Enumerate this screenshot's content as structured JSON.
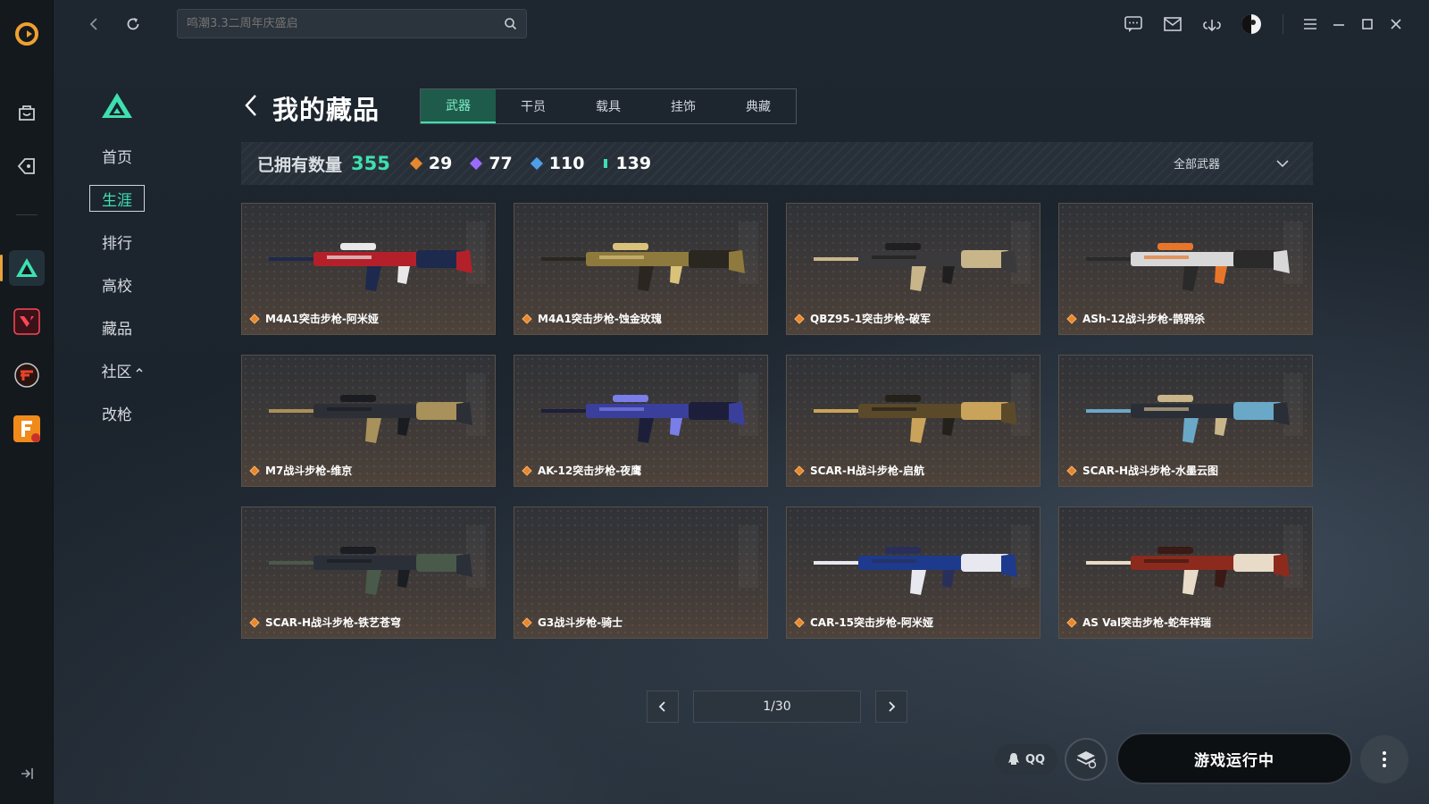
{
  "search": {
    "placeholder": "鸣潮3.3二周年庆盛启"
  },
  "sidenav": {
    "items": [
      {
        "label": "首页"
      },
      {
        "label": "生涯"
      },
      {
        "label": "排行"
      },
      {
        "label": "高校"
      },
      {
        "label": "藏品"
      },
      {
        "label": "社区"
      },
      {
        "label": "改枪"
      }
    ],
    "active_index": 1
  },
  "page": {
    "title": "我的藏品",
    "tabs": [
      {
        "label": "武器"
      },
      {
        "label": "干员"
      },
      {
        "label": "载具"
      },
      {
        "label": "挂饰"
      },
      {
        "label": "典藏"
      }
    ],
    "active_tab": 0
  },
  "stats": {
    "owned_label": "已拥有数量",
    "owned_total": "355",
    "tiers": [
      {
        "value": "29",
        "color": "#e7882e"
      },
      {
        "value": "77",
        "color": "#9b6bff"
      },
      {
        "value": "110",
        "color": "#4f9eea"
      },
      {
        "value": "139",
        "color": "#3ee0b0"
      }
    ],
    "filter_label": "全部武器"
  },
  "items": [
    {
      "name": "M4A1突击步枪-阿米娅",
      "colors": [
        "#b3202a",
        "#1d2a4d",
        "#e8e8e8"
      ]
    },
    {
      "name": "M4A1突击步枪-蚀金玫瑰",
      "colors": [
        "#8e7a3c",
        "#2a2620",
        "#d9c27a"
      ]
    },
    {
      "name": "QBZ95-1突击步枪-破军",
      "colors": [
        "#3a3a3c",
        "#c8b58a",
        "#1f1f20"
      ]
    },
    {
      "name": "ASh-12战斗步枪-鹊鸦杀",
      "colors": [
        "#d8d8d8",
        "#2a2a2a",
        "#e8762a"
      ]
    },
    {
      "name": "M7战斗步枪-维京",
      "colors": [
        "#2d2f36",
        "#a8915a",
        "#1a1c22"
      ]
    },
    {
      "name": "AK-12突击步枪-夜鹰",
      "colors": [
        "#3a3f9c",
        "#1d1f3a",
        "#7a7ee8"
      ]
    },
    {
      "name": "SCAR-H战斗步枪-启航",
      "colors": [
        "#5a4a2a",
        "#c9a35a",
        "#24201a"
      ]
    },
    {
      "name": "SCAR-H战斗步枪-水墨云图",
      "colors": [
        "#2a2e36",
        "#6aa8c8",
        "#c8b58a"
      ]
    },
    {
      "name": "SCAR-H战斗步枪-铁艺苍穹",
      "colors": [
        "#2a2f38",
        "#4a5a4a",
        "#1a1d22"
      ]
    },
    {
      "name": "G3战斗步枪-骑士",
      "colors": []
    },
    {
      "name": "CAR-15突击步枪-阿米娅",
      "colors": [
        "#1d3a8c",
        "#e8e8f0",
        "#2a2f5a"
      ]
    },
    {
      "name": "AS Val突击步枪-蛇年祥瑞",
      "colors": [
        "#8c2a1d",
        "#e8dcc8",
        "#3a1a14"
      ]
    }
  ],
  "pager": {
    "text": "1/30"
  },
  "footer": {
    "qq_label": "QQ",
    "play_label": "游戏运行中"
  }
}
